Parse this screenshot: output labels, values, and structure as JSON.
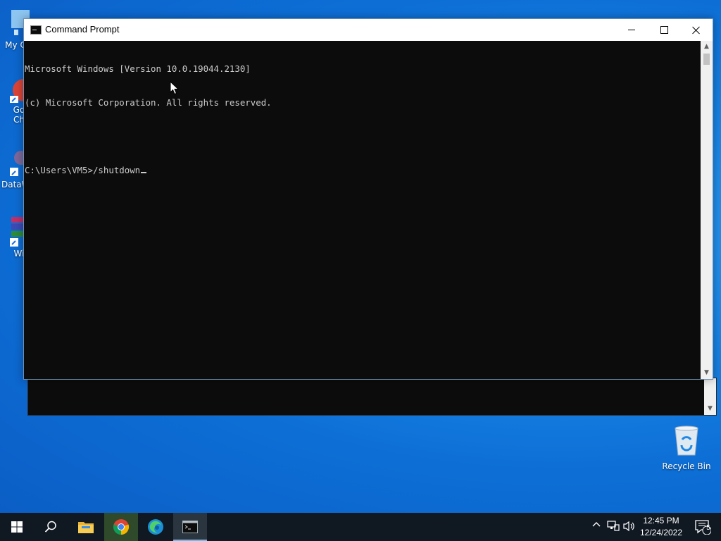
{
  "desktop": {
    "icons": [
      {
        "label": "My C"
      },
      {
        "label": "Go"
      },
      {
        "label": "Ch"
      },
      {
        "label": "DataW"
      },
      {
        "label": "Wi"
      },
      {
        "label": "Recycle Bin"
      }
    ]
  },
  "window": {
    "title": "Command Prompt",
    "console_lines": [
      "Microsoft Windows [Version 10.0.19044.2130]",
      "(c) Microsoft Corporation. All rights reserved.",
      "",
      "C:\\Users\\VM5>/shutdown"
    ]
  },
  "taskbar": {
    "apps": [
      "start-icon",
      "search-icon",
      "file-explorer-icon",
      "chrome-icon",
      "edge-icon",
      "command-prompt-icon"
    ],
    "clock_time": "12:45 PM",
    "clock_date": "12/24/2022",
    "notification_count": "5"
  },
  "colors": {
    "console_bg": "#0c0c0c",
    "console_fg": "#cccccc",
    "taskbar_bg": "#101822",
    "accent": "#76b9ed"
  }
}
